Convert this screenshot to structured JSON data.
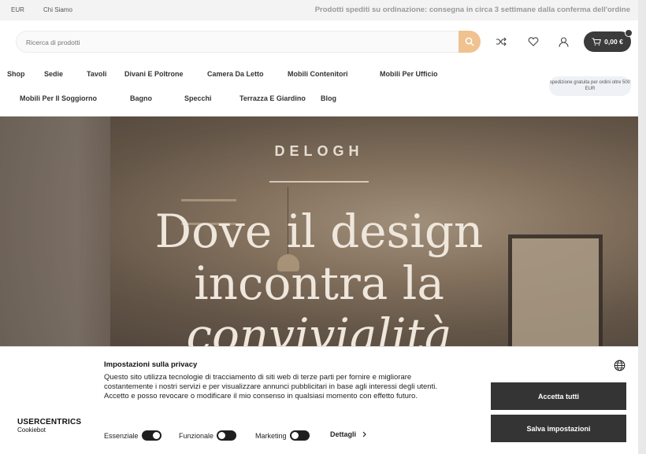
{
  "topbar": {
    "currency": "EUR",
    "about": "Chi Siamo",
    "shipping_notice": "Prodotti spediti su ordinazione: consegna in circa 3 settimane dalla conferma dell'ordine"
  },
  "header": {
    "search_placeholder": "Ricerca di prodotti",
    "cart_total": "0,00 €",
    "free_shipping": "spedizione gratuita per ordini oltre 500 EUR"
  },
  "nav": {
    "row1": [
      "Shop",
      "Sedie",
      "Tavoli",
      "Divani E Poltrone",
      "Camera Da Letto",
      "Mobili Contenitori",
      "Mobili Per Ufficio"
    ],
    "row2": [
      "Mobili Per Il Soggiorno",
      "Bagno",
      "Specchi",
      "Terrazza E Giardino",
      "Blog"
    ]
  },
  "hero": {
    "brand": "DELOGH",
    "headline_line1": "Dove il design",
    "headline_line2": "incontra la",
    "headline_line3": "convivialità"
  },
  "cookie": {
    "title": "Impostazioni sulla privacy",
    "text": "Questo sito utilizza tecnologie di tracciamento di siti web di terze parti per fornire e migliorare costantemente i nostri servizi e per visualizzare annunci pubblicitari in base agli interessi degli utenti. Accetto e posso revocare o modificare il mio consenso in qualsiasi momento con effetto futuro.",
    "logo_main": "USERCENTRICS",
    "logo_sub": "Cookiebot",
    "accept_all": "Accetta tutti",
    "save_settings": "Salva impostazioni",
    "toggle_essential": "Essenziale",
    "toggle_functional": "Funzionale",
    "toggle_marketing": "Marketing",
    "details": "Dettagli",
    "toggle_states": {
      "essential": true,
      "functional": false,
      "marketing": false
    }
  },
  "icons": {
    "search": "search-icon",
    "shuffle": "compare-icon",
    "heart": "heart-icon",
    "user": "user-icon",
    "cart": "cart-icon",
    "globe": "globe-icon",
    "chevron": "chevron-right-icon"
  },
  "colors": {
    "accent": "#f0c28f",
    "dark_button": "#343434"
  }
}
